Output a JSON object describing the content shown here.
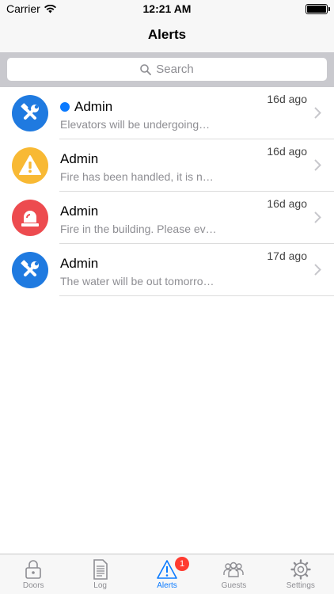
{
  "status_bar": {
    "carrier": "Carrier",
    "time": "12:21 AM"
  },
  "nav": {
    "title": "Alerts"
  },
  "search": {
    "placeholder": "Search"
  },
  "alerts": [
    {
      "sender": "Admin",
      "preview": "Elevators will be undergoing…",
      "time": "16d ago",
      "icon": "tools-icon",
      "color": "#1f7ae0",
      "unread": true
    },
    {
      "sender": "Admin",
      "preview": "Fire has been handled, it is n…",
      "time": "16d ago",
      "icon": "warning-icon",
      "color": "#f8b934",
      "unread": false
    },
    {
      "sender": "Admin",
      "preview": "Fire in the building. Please ev…",
      "time": "16d ago",
      "icon": "alarm-light-icon",
      "color": "#ed4b4f",
      "unread": false
    },
    {
      "sender": "Admin",
      "preview": "The water will be out tomorro…",
      "time": "17d ago",
      "icon": "tools-icon",
      "color": "#1f7ae0",
      "unread": false
    }
  ],
  "tabs": [
    {
      "label": "Doors",
      "icon": "lock-icon"
    },
    {
      "label": "Log",
      "icon": "document-icon"
    },
    {
      "label": "Alerts",
      "icon": "alert-icon",
      "active": true,
      "badge": "1"
    },
    {
      "label": "Guests",
      "icon": "guests-icon"
    },
    {
      "label": "Settings",
      "icon": "gear-icon"
    }
  ],
  "colors": {
    "accent": "#0a7aff",
    "badge": "#ff3b30"
  }
}
